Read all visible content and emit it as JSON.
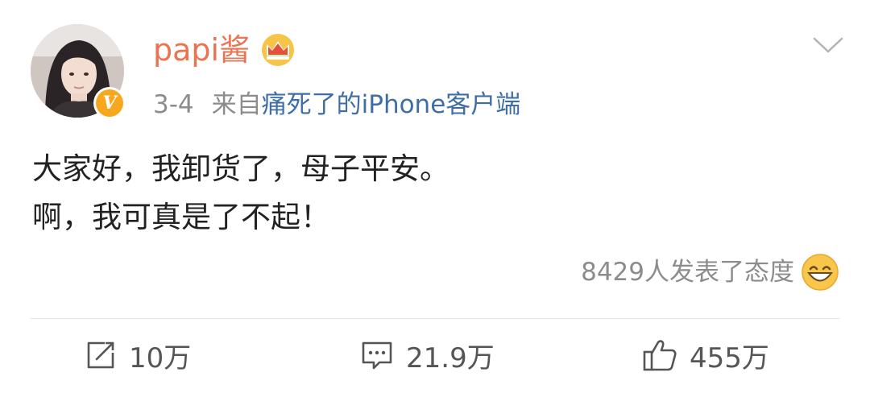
{
  "post": {
    "author": {
      "name": "papi酱",
      "avatar_icon": "avatar-photo",
      "verified_badge": "V",
      "vip_icon": "crown-icon",
      "name_color": "#eb7350"
    },
    "meta": {
      "time": "3-4",
      "source_prefix": "来自",
      "source": "痛死了的iPhone客户端",
      "source_color": "#3f6ea6"
    },
    "content": {
      "line1": "大家好，我卸货了，母子平安。",
      "line2": "啊，我可真是了不起！"
    },
    "attitude": {
      "text": "8429人发表了态度",
      "icon": "grinning-emoji-icon"
    },
    "actions": {
      "repost": {
        "icon": "repost-icon",
        "count": "10万"
      },
      "comment": {
        "icon": "comment-icon",
        "count": "21.9万"
      },
      "like": {
        "icon": "thumbs-up-icon",
        "count": "455万"
      }
    },
    "menu_icon": "chevron-down-icon"
  }
}
